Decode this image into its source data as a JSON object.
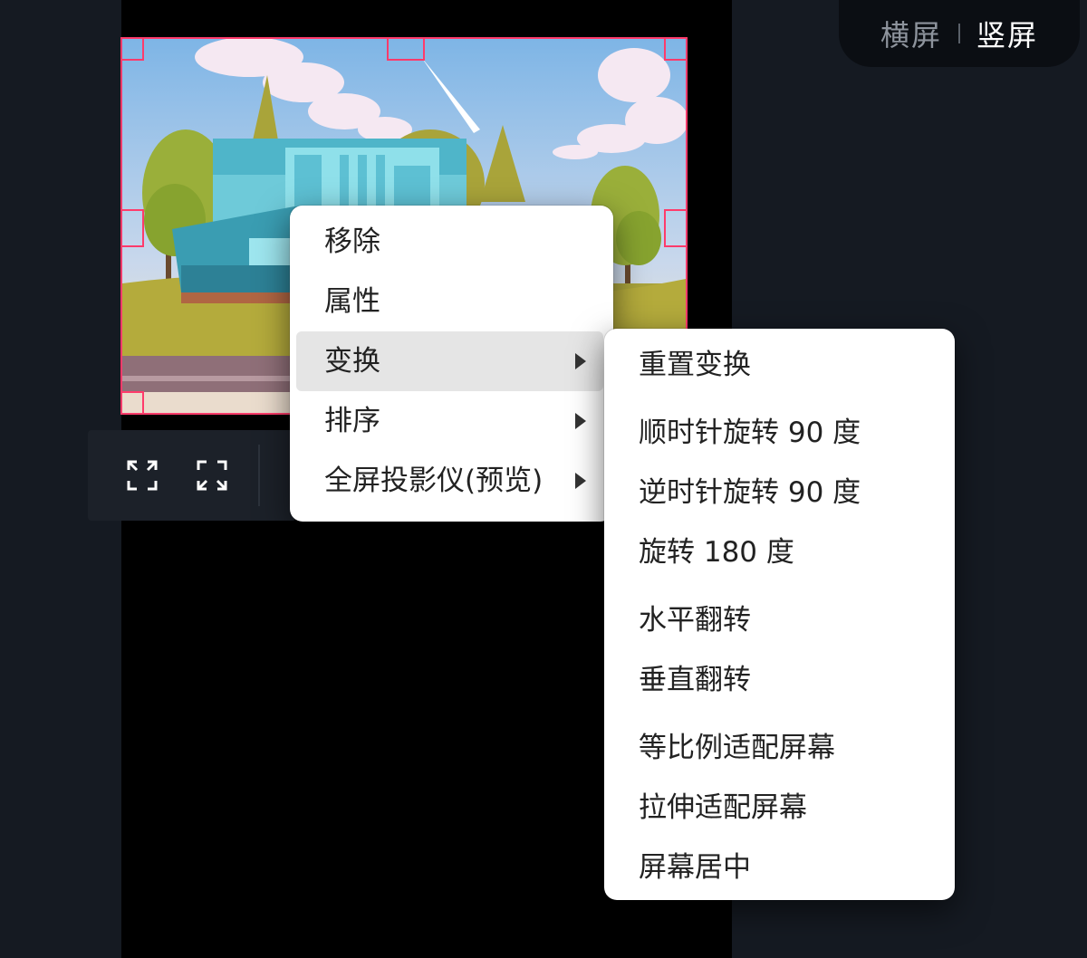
{
  "orientation": {
    "landscape_label": "横屏",
    "portrait_label": "竖屏",
    "selected": "portrait"
  },
  "toolbar": {
    "icons": [
      "expand-icon",
      "fullscreen-icon"
    ]
  },
  "context_menu": {
    "items": [
      {
        "label": "移除",
        "has_submenu": false
      },
      {
        "label": "属性",
        "has_submenu": false
      },
      {
        "label": "变换",
        "has_submenu": true,
        "highlighted": true
      },
      {
        "label": "排序",
        "has_submenu": true
      },
      {
        "label": "全屏投影仪(预览)",
        "has_submenu": true
      }
    ]
  },
  "transform_submenu": {
    "items": [
      {
        "label": "重置变换"
      },
      {
        "label": "顺时针旋转 90 度"
      },
      {
        "label": "逆时针旋转 90 度"
      },
      {
        "label": "旋转 180 度"
      },
      {
        "label": "水平翻转"
      },
      {
        "label": "垂直翻转"
      },
      {
        "label": "等比例适配屏幕"
      },
      {
        "label": "拉伸适配屏幕"
      },
      {
        "label": "屏幕居中"
      }
    ]
  },
  "colors": {
    "app_background": "#151a22",
    "canvas": "#000000",
    "selection_border": "#ff3b6b",
    "menu_background": "#ffffff",
    "menu_highlight": "#e5e5e5",
    "toggle_active": "#ffffff",
    "toggle_inactive": "#8d939c"
  }
}
